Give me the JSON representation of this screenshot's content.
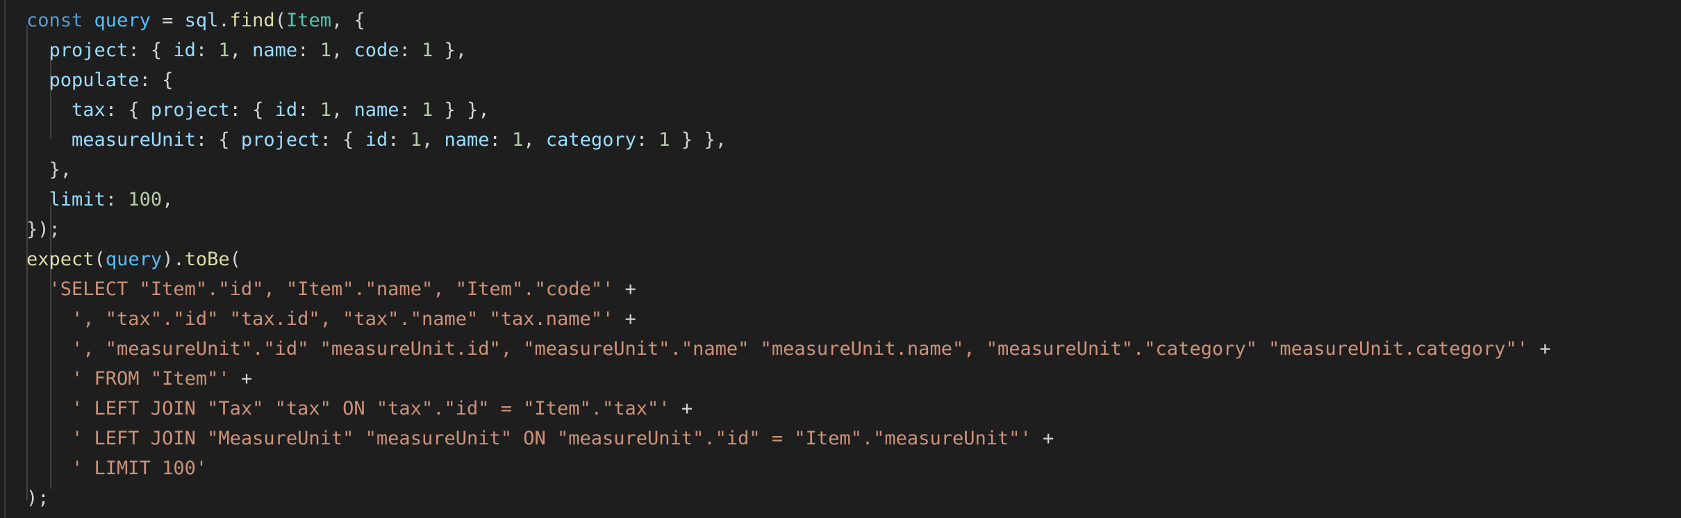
{
  "editor": {
    "theme_background": "#1e1e1e",
    "colors": {
      "keyword": "#569cd6",
      "variable": "#4fc1ff",
      "property": "#9cdcfe",
      "function": "#dcdcaa",
      "class": "#4ec9b0",
      "number": "#b5cea8",
      "string": "#ce9178",
      "punctuation": "#d4d4d4"
    },
    "lines": [
      {
        "tokens": [
          {
            "t": "kw",
            "v": "const"
          },
          {
            "t": "pun",
            "v": " "
          },
          {
            "t": "var",
            "v": "query"
          },
          {
            "t": "pun",
            "v": " = "
          },
          {
            "t": "prop",
            "v": "sql"
          },
          {
            "t": "pun",
            "v": "."
          },
          {
            "t": "fn",
            "v": "find"
          },
          {
            "t": "pun",
            "v": "("
          },
          {
            "t": "cls",
            "v": "Item"
          },
          {
            "t": "pun",
            "v": ", {"
          }
        ]
      },
      {
        "tokens": [
          {
            "t": "pun",
            "v": "  "
          },
          {
            "t": "prop",
            "v": "project"
          },
          {
            "t": "pun",
            "v": ": { "
          },
          {
            "t": "prop",
            "v": "id"
          },
          {
            "t": "pun",
            "v": ": "
          },
          {
            "t": "num",
            "v": "1"
          },
          {
            "t": "pun",
            "v": ", "
          },
          {
            "t": "prop",
            "v": "name"
          },
          {
            "t": "pun",
            "v": ": "
          },
          {
            "t": "num",
            "v": "1"
          },
          {
            "t": "pun",
            "v": ", "
          },
          {
            "t": "prop",
            "v": "code"
          },
          {
            "t": "pun",
            "v": ": "
          },
          {
            "t": "num",
            "v": "1"
          },
          {
            "t": "pun",
            "v": " },"
          }
        ]
      },
      {
        "tokens": [
          {
            "t": "pun",
            "v": "  "
          },
          {
            "t": "prop",
            "v": "populate"
          },
          {
            "t": "pun",
            "v": ": {"
          }
        ]
      },
      {
        "tokens": [
          {
            "t": "pun",
            "v": "    "
          },
          {
            "t": "prop",
            "v": "tax"
          },
          {
            "t": "pun",
            "v": ": { "
          },
          {
            "t": "prop",
            "v": "project"
          },
          {
            "t": "pun",
            "v": ": { "
          },
          {
            "t": "prop",
            "v": "id"
          },
          {
            "t": "pun",
            "v": ": "
          },
          {
            "t": "num",
            "v": "1"
          },
          {
            "t": "pun",
            "v": ", "
          },
          {
            "t": "prop",
            "v": "name"
          },
          {
            "t": "pun",
            "v": ": "
          },
          {
            "t": "num",
            "v": "1"
          },
          {
            "t": "pun",
            "v": " } },"
          }
        ]
      },
      {
        "tokens": [
          {
            "t": "pun",
            "v": "    "
          },
          {
            "t": "prop",
            "v": "measureUnit"
          },
          {
            "t": "pun",
            "v": ": { "
          },
          {
            "t": "prop",
            "v": "project"
          },
          {
            "t": "pun",
            "v": ": { "
          },
          {
            "t": "prop",
            "v": "id"
          },
          {
            "t": "pun",
            "v": ": "
          },
          {
            "t": "num",
            "v": "1"
          },
          {
            "t": "pun",
            "v": ", "
          },
          {
            "t": "prop",
            "v": "name"
          },
          {
            "t": "pun",
            "v": ": "
          },
          {
            "t": "num",
            "v": "1"
          },
          {
            "t": "pun",
            "v": ", "
          },
          {
            "t": "prop",
            "v": "category"
          },
          {
            "t": "pun",
            "v": ": "
          },
          {
            "t": "num",
            "v": "1"
          },
          {
            "t": "pun",
            "v": " } },"
          }
        ]
      },
      {
        "tokens": [
          {
            "t": "pun",
            "v": "  },"
          }
        ]
      },
      {
        "tokens": [
          {
            "t": "pun",
            "v": "  "
          },
          {
            "t": "prop",
            "v": "limit"
          },
          {
            "t": "pun",
            "v": ": "
          },
          {
            "t": "num",
            "v": "100"
          },
          {
            "t": "pun",
            "v": ","
          }
        ]
      },
      {
        "tokens": [
          {
            "t": "pun",
            "v": "});"
          }
        ]
      },
      {
        "tokens": [
          {
            "t": "fn",
            "v": "expect"
          },
          {
            "t": "pun",
            "v": "("
          },
          {
            "t": "var",
            "v": "query"
          },
          {
            "t": "pun",
            "v": ")."
          },
          {
            "t": "fn",
            "v": "toBe"
          },
          {
            "t": "pun",
            "v": "("
          }
        ]
      },
      {
        "tokens": [
          {
            "t": "pun",
            "v": "  "
          },
          {
            "t": "str",
            "v": "'SELECT \"Item\".\"id\", \"Item\".\"name\", \"Item\".\"code\"'"
          },
          {
            "t": "pun",
            "v": " +"
          }
        ]
      },
      {
        "tokens": [
          {
            "t": "pun",
            "v": "    "
          },
          {
            "t": "str",
            "v": "', \"tax\".\"id\" \"tax.id\", \"tax\".\"name\" \"tax.name\"'"
          },
          {
            "t": "pun",
            "v": " +"
          }
        ]
      },
      {
        "tokens": [
          {
            "t": "pun",
            "v": "    "
          },
          {
            "t": "str",
            "v": "', \"measureUnit\".\"id\" \"measureUnit.id\", \"measureUnit\".\"name\" \"measureUnit.name\", \"measureUnit\".\"category\" \"measureUnit.category\"'"
          },
          {
            "t": "pun",
            "v": " +"
          }
        ]
      },
      {
        "tokens": [
          {
            "t": "pun",
            "v": "    "
          },
          {
            "t": "str",
            "v": "' FROM \"Item\"'"
          },
          {
            "t": "pun",
            "v": " +"
          }
        ]
      },
      {
        "tokens": [
          {
            "t": "pun",
            "v": "    "
          },
          {
            "t": "str",
            "v": "' LEFT JOIN \"Tax\" \"tax\" ON \"tax\".\"id\" = \"Item\".\"tax\"'"
          },
          {
            "t": "pun",
            "v": " +"
          }
        ]
      },
      {
        "tokens": [
          {
            "t": "pun",
            "v": "    "
          },
          {
            "t": "str",
            "v": "' LEFT JOIN \"MeasureUnit\" \"measureUnit\" ON \"measureUnit\".\"id\" = \"Item\".\"measureUnit\"'"
          },
          {
            "t": "pun",
            "v": " +"
          }
        ]
      },
      {
        "tokens": [
          {
            "t": "pun",
            "v": "    "
          },
          {
            "t": "str",
            "v": "' LIMIT 100'"
          }
        ]
      },
      {
        "tokens": [
          {
            "t": "pun",
            "v": ");"
          }
        ]
      }
    ]
  }
}
